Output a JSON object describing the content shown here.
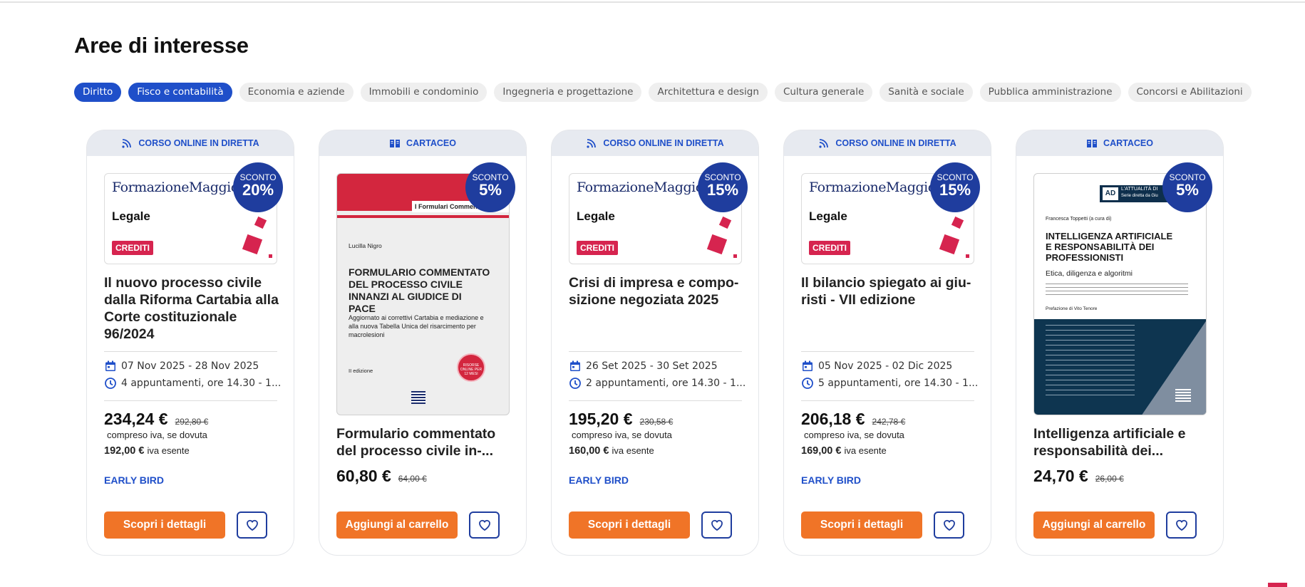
{
  "section": {
    "title": "Aree di interesse"
  },
  "filters": [
    {
      "label": "Diritto",
      "active": true
    },
    {
      "label": "Fisco e contabilità",
      "active": true
    },
    {
      "label": "Economia e aziende",
      "active": false
    },
    {
      "label": "Immobili e condominio",
      "active": false
    },
    {
      "label": "Ingegneria e progettazione",
      "active": false
    },
    {
      "label": "Architettura e design",
      "active": false
    },
    {
      "label": "Cultura generale",
      "active": false
    },
    {
      "label": "Sanità e sociale",
      "active": false
    },
    {
      "label": "Pubblica amministrazione",
      "active": false
    },
    {
      "label": "Concorsi e Abilitazioni",
      "active": false
    }
  ],
  "colors": {
    "brand_blue": "#1f4fc9",
    "badge_blue": "#1f3d9e",
    "cta_orange": "#f07427",
    "accent_red": "#d6244f"
  },
  "cards": [
    {
      "type_label": "CORSO ONLINE IN DIRETTA",
      "type_icon": "rss-icon",
      "thumb": {
        "logo": "FormazioneMaggioli",
        "category": "Legale",
        "tag": "CREDITI"
      },
      "badge": {
        "label": "SCONTO",
        "value": "20%"
      },
      "title": "Il nuovo processo civile dalla Riforma Cartabia alla Corte costituzionale 96/2024",
      "dates": "07 Nov 2025 - 28 Nov 2025",
      "schedule": "4 appuntamenti, ore 14.30 - 1...",
      "price": "234,24 €",
      "old_price": "292,80 €",
      "price_note": "compreso iva, se dovuta",
      "price_ex": "192,00 €",
      "price_ex_note": "iva esente",
      "promo": "EARLY BIRD",
      "cta": "Scopri i dettagli"
    },
    {
      "type_label": "CARTACEO",
      "type_icon": "book-icon",
      "thumb": {
        "series": "I Formulari Commentati",
        "author": "Lucilla Nigro",
        "title": "FORMULARIO COMMENTATO DEL PROCESSO CIVILE INNANZI AL GIUDICE DI PACE",
        "subtitle": "Aggiornato ai correttivi Cartabia e mediazione e alla nuova Tabella Unica del risarcimento per macrolesioni",
        "edition": "II edizione",
        "seal": "RISORSE ONLINE PER 12 MESI"
      },
      "badge": {
        "label": "SCONTO",
        "value": "5%"
      },
      "title": "Formulario commentato del processo civile in-...",
      "price": "60,80 €",
      "old_price": "64,00 €",
      "cta": "Aggiungi al carrello"
    },
    {
      "type_label": "CORSO ONLINE IN DIRETTA",
      "type_icon": "rss-icon",
      "thumb": {
        "logo": "FormazioneMaggioli",
        "category": "Legale",
        "tag": "CREDITI"
      },
      "badge": {
        "label": "SCONTO",
        "value": "15%"
      },
      "title": "Crisi di impresa e compo-sizione negoziata 2025",
      "dates": "26 Set 2025 - 30 Set 2025",
      "schedule": "2 appuntamenti, ore 14.30 - 1...",
      "price": "195,20 €",
      "old_price": "230,58 €",
      "price_note": "compreso iva, se dovuta",
      "price_ex": "160,00 €",
      "price_ex_note": "iva esente",
      "promo": "EARLY BIRD",
      "cta": "Scopri i dettagli"
    },
    {
      "type_label": "CORSO ONLINE IN DIRETTA",
      "type_icon": "rss-icon",
      "thumb": {
        "logo": "FormazioneMaggioli",
        "category": "Legale",
        "tag": "CREDITI"
      },
      "badge": {
        "label": "SCONTO",
        "value": "15%"
      },
      "title": "Il bilancio spiegato ai giu-risti - VII edizione",
      "dates": "05 Nov 2025 - 02 Dic 2025",
      "schedule": "5 appuntamenti, ore 14.30 - 1...",
      "price": "206,18 €",
      "old_price": "242,78 €",
      "price_note": "compreso iva, se dovuta",
      "price_ex": "169,00 €",
      "price_ex_note": "iva esente",
      "promo": "EARLY BIRD",
      "cta": "Scopri i dettagli"
    },
    {
      "type_label": "CARTACEO",
      "type_icon": "book-icon",
      "thumb": {
        "series": "L'ATTUALITÀ DI",
        "series_sub": "Serie diretta da Giu",
        "author": "Francesca Toppetti (a cura di)",
        "title": "INTELLIGENZA ARTIFICIALE E RESPONSABILITÀ DEI PROFESSIONISTI",
        "subtitle": "Etica, diligenza e algoritmi",
        "preface": "Prefazione di Vito Tenore"
      },
      "badge": {
        "label": "SCONTO",
        "value": "5%"
      },
      "title": "Intelligenza artificiale e responsabilità dei...",
      "price": "24,70 €",
      "old_price": "26,00 €",
      "cta": "Aggiungi al carrello"
    }
  ]
}
